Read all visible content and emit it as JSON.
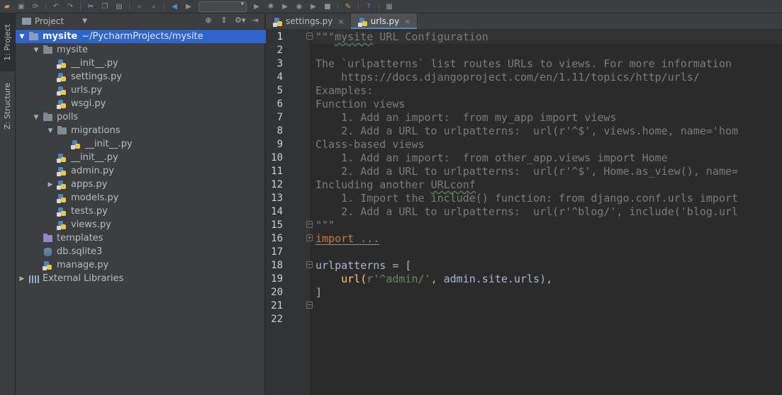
{
  "toolbar": {
    "icons": [
      "open-icon",
      "save-icon",
      "sync-icon",
      "undo-icon",
      "redo-icon",
      "cut-icon",
      "copy-icon",
      "paste-icon",
      "find-icon",
      "replace-icon",
      "back-icon",
      "forward-icon",
      "run-config-dropdown",
      "run-icon",
      "debug-icon",
      "coverage-icon",
      "profile-icon",
      "stop-icon",
      "settings-icon",
      "help-icon",
      "vcs-icon"
    ]
  },
  "stripe": {
    "project_tab": "1: Project",
    "structure_tab": "Z: Structure"
  },
  "project_panel": {
    "title": "Project",
    "tree": [
      {
        "label": "mysite",
        "suffix": "~/PycharmProjects/mysite",
        "type": "folder",
        "indent": 0,
        "expanded": true,
        "selected": true
      },
      {
        "label": "mysite",
        "type": "folder",
        "indent": 1,
        "expanded": true
      },
      {
        "label": "__init__.py",
        "type": "py",
        "indent": 2
      },
      {
        "label": "settings.py",
        "type": "py",
        "indent": 2
      },
      {
        "label": "urls.py",
        "type": "py",
        "indent": 2
      },
      {
        "label": "wsgi.py",
        "type": "py",
        "indent": 2
      },
      {
        "label": "polls",
        "type": "folder",
        "indent": 1,
        "expanded": true
      },
      {
        "label": "migrations",
        "type": "folder",
        "indent": 2,
        "expanded": true
      },
      {
        "label": "__init__.py",
        "type": "py",
        "indent": 3
      },
      {
        "label": "__init__.py",
        "type": "py",
        "indent": 2
      },
      {
        "label": "admin.py",
        "type": "py",
        "indent": 2
      },
      {
        "label": "apps.py",
        "type": "py",
        "indent": 2,
        "collapsed": true
      },
      {
        "label": "models.py",
        "type": "py",
        "indent": 2
      },
      {
        "label": "tests.py",
        "type": "py",
        "indent": 2
      },
      {
        "label": "views.py",
        "type": "py",
        "indent": 2
      },
      {
        "label": "templates",
        "type": "folder-purple",
        "indent": 1
      },
      {
        "label": "db.sqlite3",
        "type": "db",
        "indent": 1
      },
      {
        "label": "manage.py",
        "type": "py",
        "indent": 1
      },
      {
        "label": "External Libraries",
        "type": "lib",
        "indent": 0,
        "collapsed": true
      }
    ]
  },
  "editor": {
    "tabs": [
      {
        "label": "settings.py",
        "active": false
      },
      {
        "label": "urls.py",
        "active": true
      }
    ],
    "line_numbers": [
      "1",
      "2",
      "3",
      "4",
      "5",
      "6",
      "7",
      "8",
      "9",
      "10",
      "11",
      "12",
      "13",
      "14",
      "15",
      "16",
      "17",
      "18",
      "19",
      "20",
      "21",
      "22"
    ],
    "lines": {
      "l1a": "\"\"\"",
      "l1b": "mysite",
      "l1c": " URL Configuration",
      "l3": "The `urlpatterns` list routes URLs to views. For more information",
      "l4": "    https://docs.djangoproject.com/en/1.11/topics/http/urls/",
      "l5": "Examples:",
      "l6": "Function views",
      "l7": "    1. Add an import:  from my_app import views",
      "l8": "    2. Add a URL to urlpatterns:  url(r'^$', views.home, name='hom",
      "l9": "Class-based views",
      "l10": "    1. Add an import:  from other_app.views import Home",
      "l11": "    2. Add a URL to urlpatterns:  url(r'^$', Home.as_view(), name=",
      "l12a": "Including another ",
      "l12b": "URLconf",
      "l13": "    1. Import the include() function: from django.conf.urls import",
      "l14": "    2. Add a URL to urlpatterns:  url(r'^blog/', include('blog.url",
      "l15": "\"\"\"",
      "l16": "import ...",
      "l19a": "urlpatterns",
      "l19b": " = [",
      "l20a": "    url(",
      "l20b": "r'^admin/'",
      "l20c": ", admin.site.urls),",
      "l21": "]"
    }
  }
}
